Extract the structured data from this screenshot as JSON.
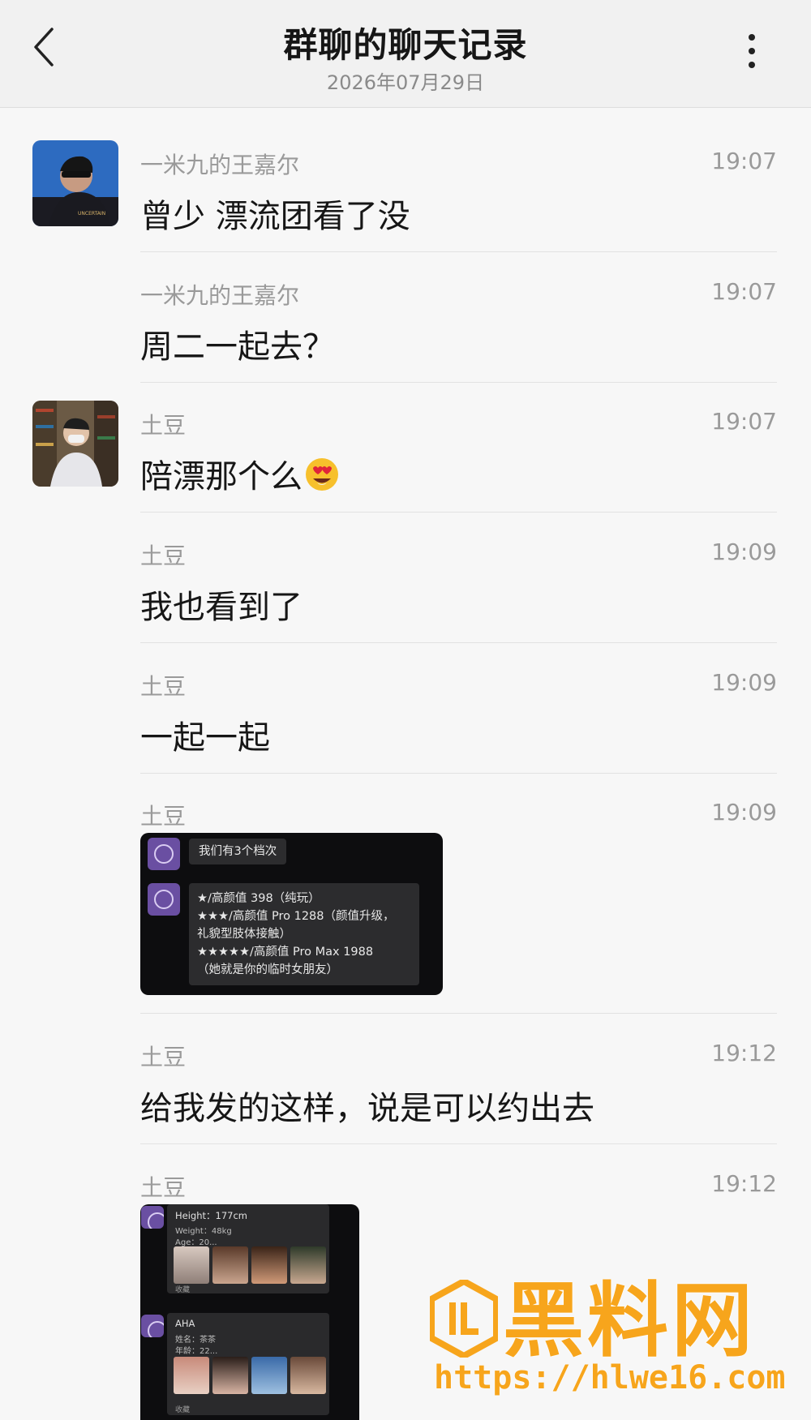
{
  "header": {
    "title": "群聊的聊天记录",
    "date": "2026年07月29日"
  },
  "messages": [
    {
      "sender": "一米九的王嘉尔",
      "time": "19:07",
      "text": "曾少 漂流团看了没"
    },
    {
      "sender": "一米九的王嘉尔",
      "time": "19:07",
      "text": "周二一起去？"
    },
    {
      "sender": "土豆",
      "time": "19:07",
      "text": "陪漂那个么"
    },
    {
      "sender": "土豆",
      "time": "19:09",
      "text": "我也看到了"
    },
    {
      "sender": "土豆",
      "time": "19:09",
      "text": "一起一起"
    },
    {
      "sender": "土豆",
      "time": "19:09"
    },
    {
      "sender": "土豆",
      "time": "19:12",
      "text": "给我发的这样，说是可以约出去"
    },
    {
      "sender": "土豆",
      "time": "19:12"
    }
  ],
  "screenshot1": {
    "bubble1": "我们有3个档次",
    "lines": [
      "★/高颜值 398（纯玩）",
      "★★★/高颜值 Pro 1288（颜值升级，",
      "礼貌型肢体接触）",
      "★★★★★/高颜值 Pro Max 1988",
      "（她就是你的临时女朋友）"
    ]
  },
  "screenshot2": {
    "card1": {
      "line1": "Height：177cm",
      "line2": "Weight：48kg",
      "line3": "Age：20...",
      "tag": "收藏"
    },
    "card2": {
      "line1": "AHA",
      "line2": "姓名：茶茶",
      "line3": "年龄：22...",
      "tag": "收藏"
    }
  },
  "watermark": {
    "text": "黑料网",
    "url": "https://hlwe16.com"
  },
  "colors": {
    "watermark": "#f7a51c",
    "muted": "#9a9a9a"
  }
}
